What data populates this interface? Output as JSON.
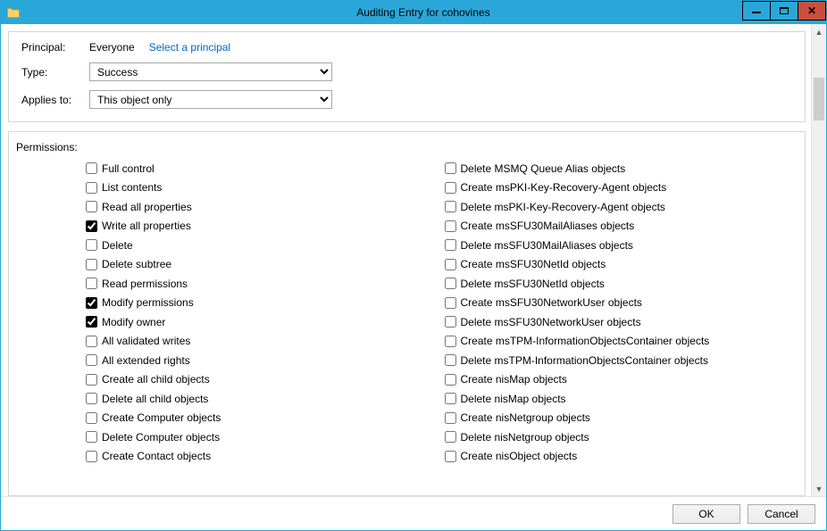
{
  "window": {
    "title": "Auditing Entry for cohovines"
  },
  "header": {
    "principal_label": "Principal:",
    "principal_value": "Everyone",
    "select_principal_link": "Select a principal",
    "type_label": "Type:",
    "type_value": "Success",
    "applies_label": "Applies to:",
    "applies_value": "This object only"
  },
  "permissions": {
    "label": "Permissions:",
    "left": [
      {
        "label": "Full control",
        "checked": false
      },
      {
        "label": "List contents",
        "checked": false
      },
      {
        "label": "Read all properties",
        "checked": false
      },
      {
        "label": "Write all properties",
        "checked": true
      },
      {
        "label": "Delete",
        "checked": false
      },
      {
        "label": "Delete subtree",
        "checked": false
      },
      {
        "label": "Read permissions",
        "checked": false
      },
      {
        "label": "Modify permissions",
        "checked": true
      },
      {
        "label": "Modify owner",
        "checked": true
      },
      {
        "label": "All validated writes",
        "checked": false
      },
      {
        "label": "All extended rights",
        "checked": false
      },
      {
        "label": "Create all child objects",
        "checked": false
      },
      {
        "label": "Delete all child objects",
        "checked": false
      },
      {
        "label": "Create Computer objects",
        "checked": false
      },
      {
        "label": "Delete Computer objects",
        "checked": false
      },
      {
        "label": "Create Contact objects",
        "checked": false
      }
    ],
    "right": [
      {
        "label": "Delete MSMQ Queue Alias objects",
        "checked": false
      },
      {
        "label": "Create msPKI-Key-Recovery-Agent objects",
        "checked": false
      },
      {
        "label": "Delete msPKI-Key-Recovery-Agent objects",
        "checked": false
      },
      {
        "label": "Create msSFU30MailAliases objects",
        "checked": false
      },
      {
        "label": "Delete msSFU30MailAliases objects",
        "checked": false
      },
      {
        "label": "Create msSFU30NetId objects",
        "checked": false
      },
      {
        "label": "Delete msSFU30NetId objects",
        "checked": false
      },
      {
        "label": "Create msSFU30NetworkUser objects",
        "checked": false
      },
      {
        "label": "Delete msSFU30NetworkUser objects",
        "checked": false
      },
      {
        "label": "Create msTPM-InformationObjectsContainer objects",
        "checked": false
      },
      {
        "label": "Delete msTPM-InformationObjectsContainer objects",
        "checked": false
      },
      {
        "label": "Create nisMap objects",
        "checked": false
      },
      {
        "label": "Delete nisMap objects",
        "checked": false
      },
      {
        "label": "Create nisNetgroup objects",
        "checked": false
      },
      {
        "label": "Delete nisNetgroup objects",
        "checked": false
      },
      {
        "label": "Create nisObject objects",
        "checked": false
      }
    ]
  },
  "footer": {
    "ok": "OK",
    "cancel": "Cancel"
  }
}
